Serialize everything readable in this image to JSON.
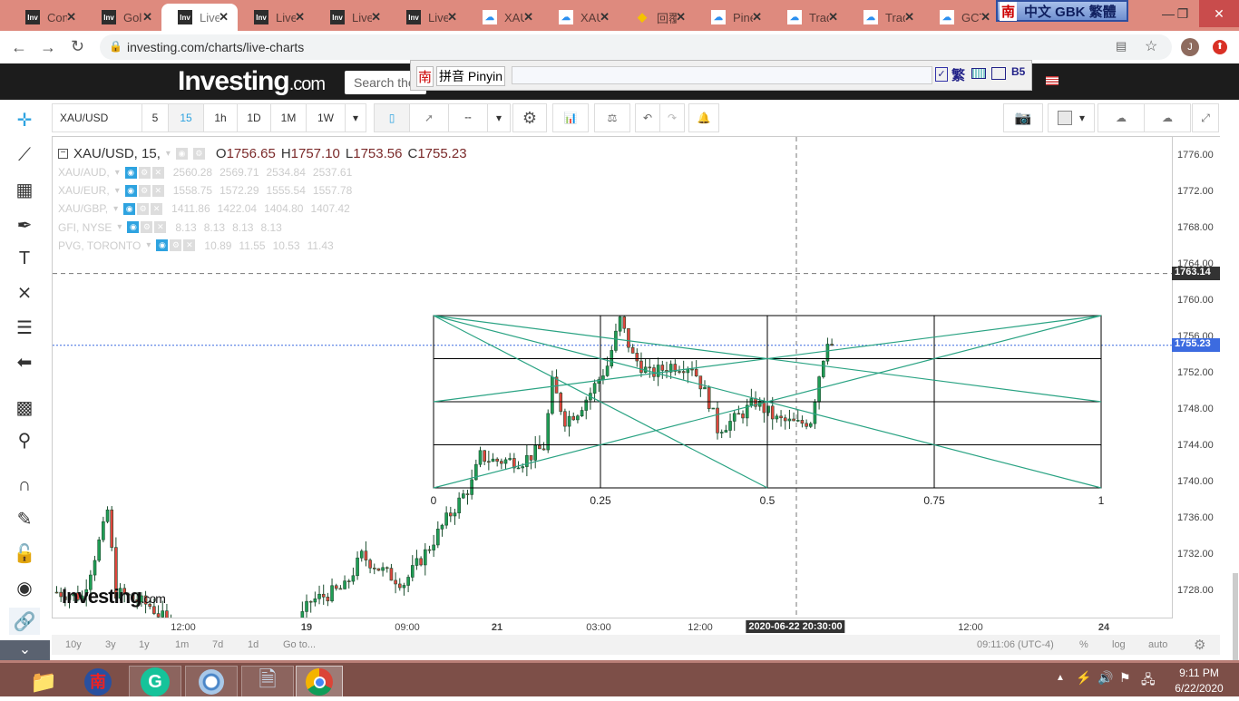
{
  "browser": {
    "tabs": [
      {
        "label": "Con",
        "icon": "inv"
      },
      {
        "label": "Gol",
        "icon": "inv"
      },
      {
        "label": "Live",
        "icon": "inv",
        "active": true
      },
      {
        "label": "Live",
        "icon": "inv"
      },
      {
        "label": "Live",
        "icon": "inv"
      },
      {
        "label": "Live",
        "icon": "inv"
      },
      {
        "label": "XAU",
        "icon": "tv"
      },
      {
        "label": "XAU",
        "icon": "tv"
      },
      {
        "label": "回覆",
        "icon": "gem"
      },
      {
        "label": "Pine",
        "icon": "tv"
      },
      {
        "label": "Trad",
        "icon": "tv"
      },
      {
        "label": "Trad",
        "icon": "tv"
      },
      {
        "label": "GCT",
        "icon": "tv"
      }
    ],
    "url": "investing.com/charts/live-charts",
    "profile_initial": "J"
  },
  "ime": {
    "top_logo": "南",
    "top_label": "中文 GBK 繁體",
    "logo": "南",
    "mode": "拼音 Pinyin",
    "trad": "繁",
    "b5": "B5"
  },
  "site": {
    "logo": "Investing",
    "logo_suffix": ".com",
    "search_placeholder": "Search the"
  },
  "toolbar": {
    "symbol": "XAU/USD",
    "intervals": [
      "5",
      "15",
      "1h",
      "1D",
      "1M",
      "1W"
    ],
    "active_interval": "15"
  },
  "legend": {
    "main": {
      "symbol": "XAU/USD, 15,",
      "o_label": "O",
      "o": "1756.65",
      "h_label": "H",
      "h": "1757.10",
      "l_label": "L",
      "l": "1753.56",
      "c_label": "C",
      "c": "1755.23"
    },
    "compare": [
      {
        "symbol": "XAU/AUD,",
        "values": [
          "2560.28",
          "2569.71",
          "2534.84",
          "2537.61"
        ]
      },
      {
        "symbol": "XAU/EUR,",
        "values": [
          "1558.75",
          "1572.29",
          "1555.54",
          "1557.78"
        ]
      },
      {
        "symbol": "XAU/GBP,",
        "values": [
          "1411.86",
          "1422.04",
          "1404.80",
          "1407.42"
        ]
      },
      {
        "symbol": "GFI, NYSE",
        "values": [
          "8.13",
          "8.13",
          "8.13",
          "8.13"
        ]
      },
      {
        "symbol": "PVG, TORONTO",
        "values": [
          "10.89",
          "11.55",
          "10.53",
          "11.43"
        ]
      }
    ]
  },
  "chart_data": {
    "type": "candlestick",
    "symbol": "XAU/USD",
    "interval": "15",
    "y_ticks": [
      "1776.00",
      "1772.00",
      "1768.00",
      "1764.00",
      "1760.00",
      "1756.00",
      "1752.00",
      "1748.00",
      "1744.00",
      "1740.00",
      "1736.00",
      "1732.00",
      "1728.00"
    ],
    "ylim": [
      1723,
      1779
    ],
    "x_ticks": [
      {
        "label": "12:00",
        "bold": false
      },
      {
        "label": "19",
        "bold": true
      },
      {
        "label": "09:00",
        "bold": false
      },
      {
        "label": "21",
        "bold": true
      },
      {
        "label": "03:00",
        "bold": false
      },
      {
        "label": "12:00",
        "bold": false
      },
      {
        "label": "12:00",
        "bold": false
      },
      {
        "label": "24",
        "bold": true
      }
    ],
    "price_path": [
      [
        0,
        1728
      ],
      [
        6,
        1727.5
      ],
      [
        11,
        1735
      ],
      [
        12,
        1737
      ],
      [
        14,
        1728
      ],
      [
        22,
        1726.5
      ],
      [
        30,
        1723
      ],
      [
        55,
        1723
      ],
      [
        60,
        1727
      ],
      [
        68,
        1728.5
      ],
      [
        72,
        1732
      ],
      [
        78,
        1730
      ],
      [
        82,
        1729
      ],
      [
        88,
        1733
      ],
      [
        92,
        1736
      ],
      [
        95,
        1738
      ],
      [
        98,
        1740
      ],
      [
        100,
        1743
      ],
      [
        103,
        1742.5
      ],
      [
        110,
        1742.5
      ],
      [
        115,
        1744
      ],
      [
        117,
        1751
      ],
      [
        120,
        1747
      ],
      [
        123,
        1748
      ],
      [
        126,
        1750
      ],
      [
        130,
        1753
      ],
      [
        133,
        1758
      ],
      [
        136,
        1754
      ],
      [
        140,
        1752
      ],
      [
        145,
        1753
      ],
      [
        150,
        1753
      ],
      [
        154,
        1749
      ],
      [
        156,
        1746
      ],
      [
        160,
        1747
      ],
      [
        165,
        1749
      ],
      [
        170,
        1747
      ],
      [
        175,
        1746.5
      ],
      [
        178,
        1747
      ],
      [
        180,
        1752
      ],
      [
        182,
        1756
      ],
      [
        183,
        1755.23
      ]
    ],
    "last_price": "1755.23",
    "crosshair_price": "1763.14",
    "crosshair_time": "2020-06-22 20:30:00",
    "gann_box": {
      "levels": [
        "0",
        "0.25",
        "0.5",
        "0.75",
        "1"
      ],
      "price_top": 1758.5,
      "price_bottom": 1739.5
    }
  },
  "watermark": "Investing.com",
  "bottom": {
    "ranges": [
      "10y",
      "3y",
      "1y",
      "1m",
      "7d",
      "1d",
      "Go to..."
    ],
    "clock": "09:11:06 (UTC-4)",
    "percent": "%",
    "log": "log",
    "auto": "auto"
  },
  "taskbar": {
    "time": "9:11 PM",
    "date": "6/22/2020"
  },
  "colors": {
    "up": "#1f9d55",
    "down": "#e0463e",
    "gann": "#2aa383",
    "last_price": "#3c6be0",
    "tab_bar": "#de8a7e",
    "taskbar": "#7d4f48"
  }
}
